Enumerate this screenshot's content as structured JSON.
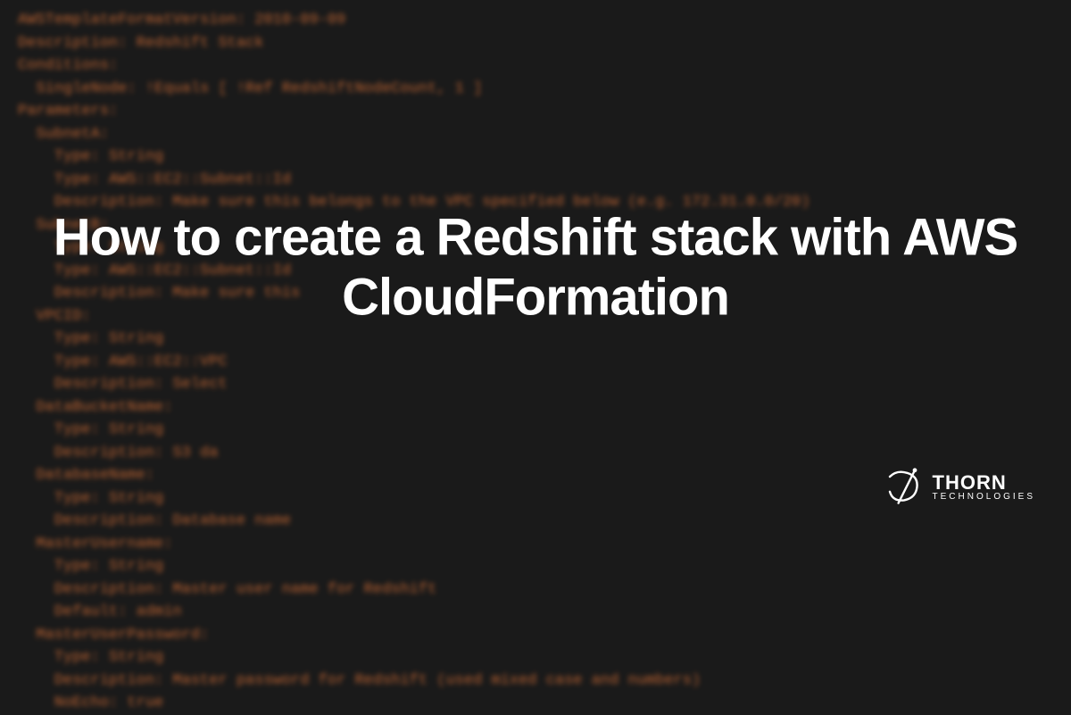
{
  "title": "How to create a Redshift stack with AWS CloudFormation",
  "logo": {
    "name": "THORN",
    "subtitle": "TECHNOLOGIES"
  },
  "code_lines": [
    {
      "text": "AWSTemplateFormatVersion: 2010-09-09"
    },
    {
      "text": "Description: Redshift Stack"
    },
    {
      "text": "Conditions:"
    },
    {
      "text": "  SingleNode: !Equals [ !Ref RedshiftNodeCount, 1 ]"
    },
    {
      "text": "Parameters:"
    },
    {
      "text": "  SubnetA:"
    },
    {
      "text": "    Type: String"
    },
    {
      "text": "    Type: AWS::EC2::Subnet::Id"
    },
    {
      "text": "    Description: Make sure this belongs to the VPC specified below (e.g. 172.31.0.0/20)"
    },
    {
      "text": "  SubnetB:"
    },
    {
      "text": "    Type: String"
    },
    {
      "text": "    Type: AWS::EC2::Subnet::Id"
    },
    {
      "text": "    Description: Make sure this"
    },
    {
      "text": "  VPCID:"
    },
    {
      "text": "    Type: String"
    },
    {
      "text": "    Type: AWS::EC2::VPC"
    },
    {
      "text": "    Description: Select"
    },
    {
      "text": "  DataBucketName:"
    },
    {
      "text": "    Type: String"
    },
    {
      "text": "    Description: S3 da"
    },
    {
      "text": "  DatabaseName:"
    },
    {
      "text": "    Type: String"
    },
    {
      "text": "    Description: Database name"
    },
    {
      "text": "  MasterUsername:"
    },
    {
      "text": "    Type: String"
    },
    {
      "text": "    Description: Master user name for Redshift"
    },
    {
      "text": "    Default: admin"
    },
    {
      "text": "  MasterUserPassword:"
    },
    {
      "text": "    Type: String"
    },
    {
      "text": "    Description: Master password for Redshift (used mixed case and numbers)"
    },
    {
      "text": "    NoEcho: true"
    }
  ]
}
